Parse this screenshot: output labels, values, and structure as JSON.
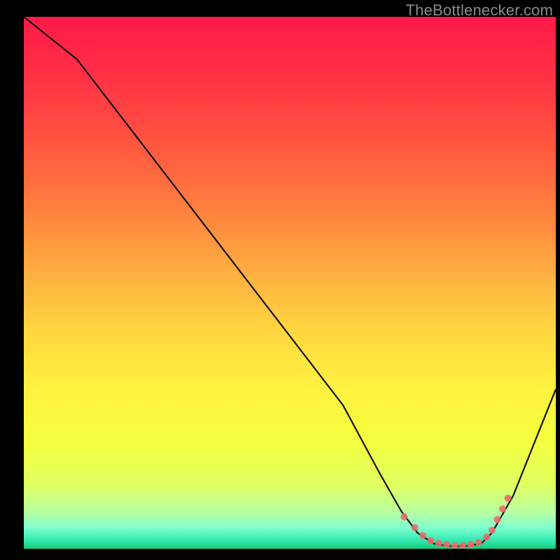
{
  "watermark": "TheBottlenecker.com",
  "chart_data": {
    "type": "line",
    "title": "",
    "xlabel": "",
    "ylabel": "",
    "xlim": [
      0,
      100
    ],
    "ylim": [
      0,
      100
    ],
    "grid": false,
    "series": [
      {
        "name": "curve",
        "x": [
          0,
          10,
          20,
          30,
          40,
          50,
          60,
          67,
          71,
          74,
          77,
          80,
          83,
          86,
          88,
          92,
          100
        ],
        "y": [
          100,
          92,
          79,
          66,
          53,
          40,
          27,
          14,
          7,
          3,
          1,
          0.5,
          0.5,
          1,
          3,
          10,
          30
        ]
      }
    ],
    "markers": {
      "x": [
        71.5,
        73.5,
        75,
        76.5,
        78,
        79.5,
        81,
        82.5,
        84,
        85.5,
        87,
        88,
        89,
        90,
        91
      ],
      "y": [
        6,
        4,
        2.5,
        1.5,
        1,
        0.8,
        0.6,
        0.6,
        0.8,
        1.2,
        2.2,
        3.5,
        5.5,
        7.5,
        9.5
      ]
    },
    "gradient_stops": [
      {
        "offset": 0.0,
        "color": "#ff1a49"
      },
      {
        "offset": 0.1,
        "color": "#ff2e45"
      },
      {
        "offset": 0.2,
        "color": "#ff4a41"
      },
      {
        "offset": 0.3,
        "color": "#ff6a3f"
      },
      {
        "offset": 0.4,
        "color": "#ff8f3f"
      },
      {
        "offset": 0.5,
        "color": "#ffb640"
      },
      {
        "offset": 0.6,
        "color": "#ffd940"
      },
      {
        "offset": 0.7,
        "color": "#fff240"
      },
      {
        "offset": 0.8,
        "color": "#f4ff40"
      },
      {
        "offset": 0.88,
        "color": "#e0ff60"
      },
      {
        "offset": 0.93,
        "color": "#b8ffa0"
      },
      {
        "offset": 0.96,
        "color": "#80ffd0"
      },
      {
        "offset": 0.985,
        "color": "#30e8b0"
      },
      {
        "offset": 1.0,
        "color": "#18c878"
      }
    ],
    "line_color": "#111111",
    "marker_color": "#ee6a6a",
    "marker_opacity": 0.9
  }
}
